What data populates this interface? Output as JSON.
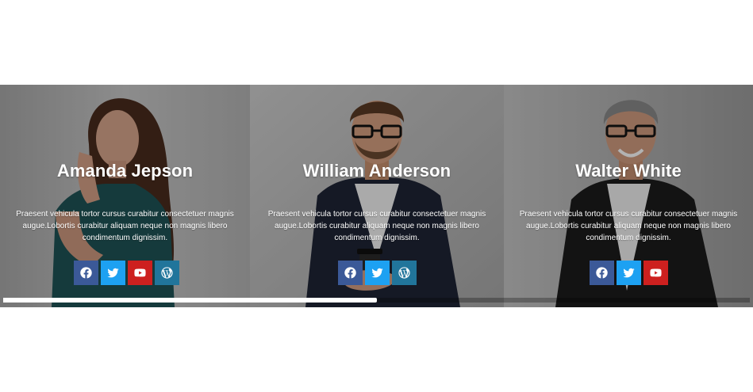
{
  "team": {
    "members": [
      {
        "name": "Amanda Jepson",
        "bio": "Praesent vehicula tortor cursus curabitur consectetuer magnis augue.Lobortis curabitur aliquam neque non magnis libero condimentum dignissim."
      },
      {
        "name": "William Anderson",
        "bio": "Praesent vehicula tortor cursus curabitur consectetuer magnis augue.Lobortis curabitur aliquam neque non magnis libero condimentum dignissim."
      },
      {
        "name": "Walter White",
        "bio": "Praesent vehicula tortor cursus curabitur consectetuer magnis augue.Lobortis curabitur aliquam neque non magnis libero condimentum dignissim."
      }
    ],
    "socials": {
      "icons": [
        "facebook-icon",
        "twitter-icon",
        "youtube-icon",
        "wordpress-icon"
      ]
    }
  },
  "carousel": {
    "scroll_progress": 0.5
  },
  "colors": {
    "facebook": "#3b5998",
    "twitter": "#1da1f2",
    "youtube": "#cd201f",
    "wordpress": "#21759b"
  }
}
